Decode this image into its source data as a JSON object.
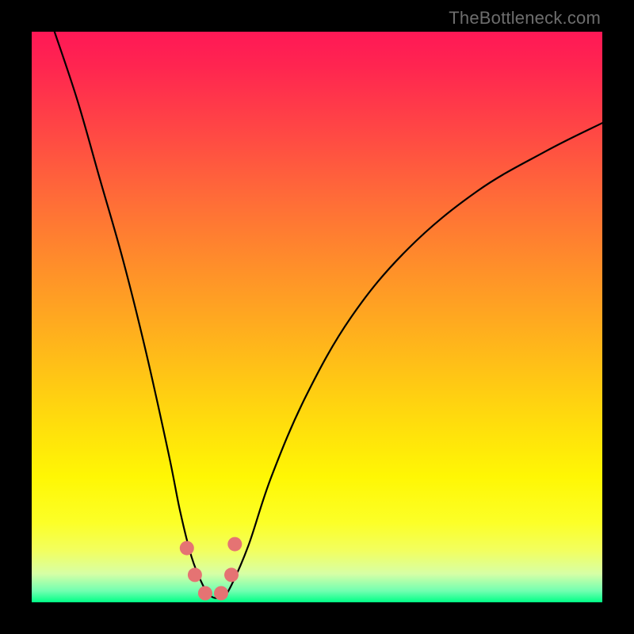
{
  "attribution": "TheBottleneck.com",
  "chart_data": {
    "type": "line",
    "title": "",
    "xlabel": "",
    "ylabel": "",
    "xlim": [
      0,
      100
    ],
    "ylim": [
      0,
      100
    ],
    "series": [
      {
        "name": "curve",
        "x": [
          4,
          8,
          12,
          16,
          20,
          24,
          26,
          28,
          30,
          31.5,
          33.5,
          35,
          38,
          42,
          48,
          56,
          66,
          78,
          90,
          100
        ],
        "y": [
          100,
          88,
          74,
          60,
          44,
          26,
          16,
          8,
          3,
          1,
          1,
          3,
          10,
          22,
          36,
          50,
          62,
          72,
          79,
          84
        ]
      }
    ],
    "markers": [
      {
        "x": 27.2,
        "y": 9.5
      },
      {
        "x": 28.6,
        "y": 4.8
      },
      {
        "x": 30.4,
        "y": 1.6
      },
      {
        "x": 33.2,
        "y": 1.6
      },
      {
        "x": 35.0,
        "y": 4.8
      },
      {
        "x": 35.6,
        "y": 10.2
      }
    ],
    "gradient_stops": [
      {
        "pos": 0,
        "color": "#ff1856"
      },
      {
        "pos": 50,
        "color": "#ffb31c"
      },
      {
        "pos": 80,
        "color": "#fff704"
      },
      {
        "pos": 100,
        "color": "#00ff86"
      }
    ]
  }
}
